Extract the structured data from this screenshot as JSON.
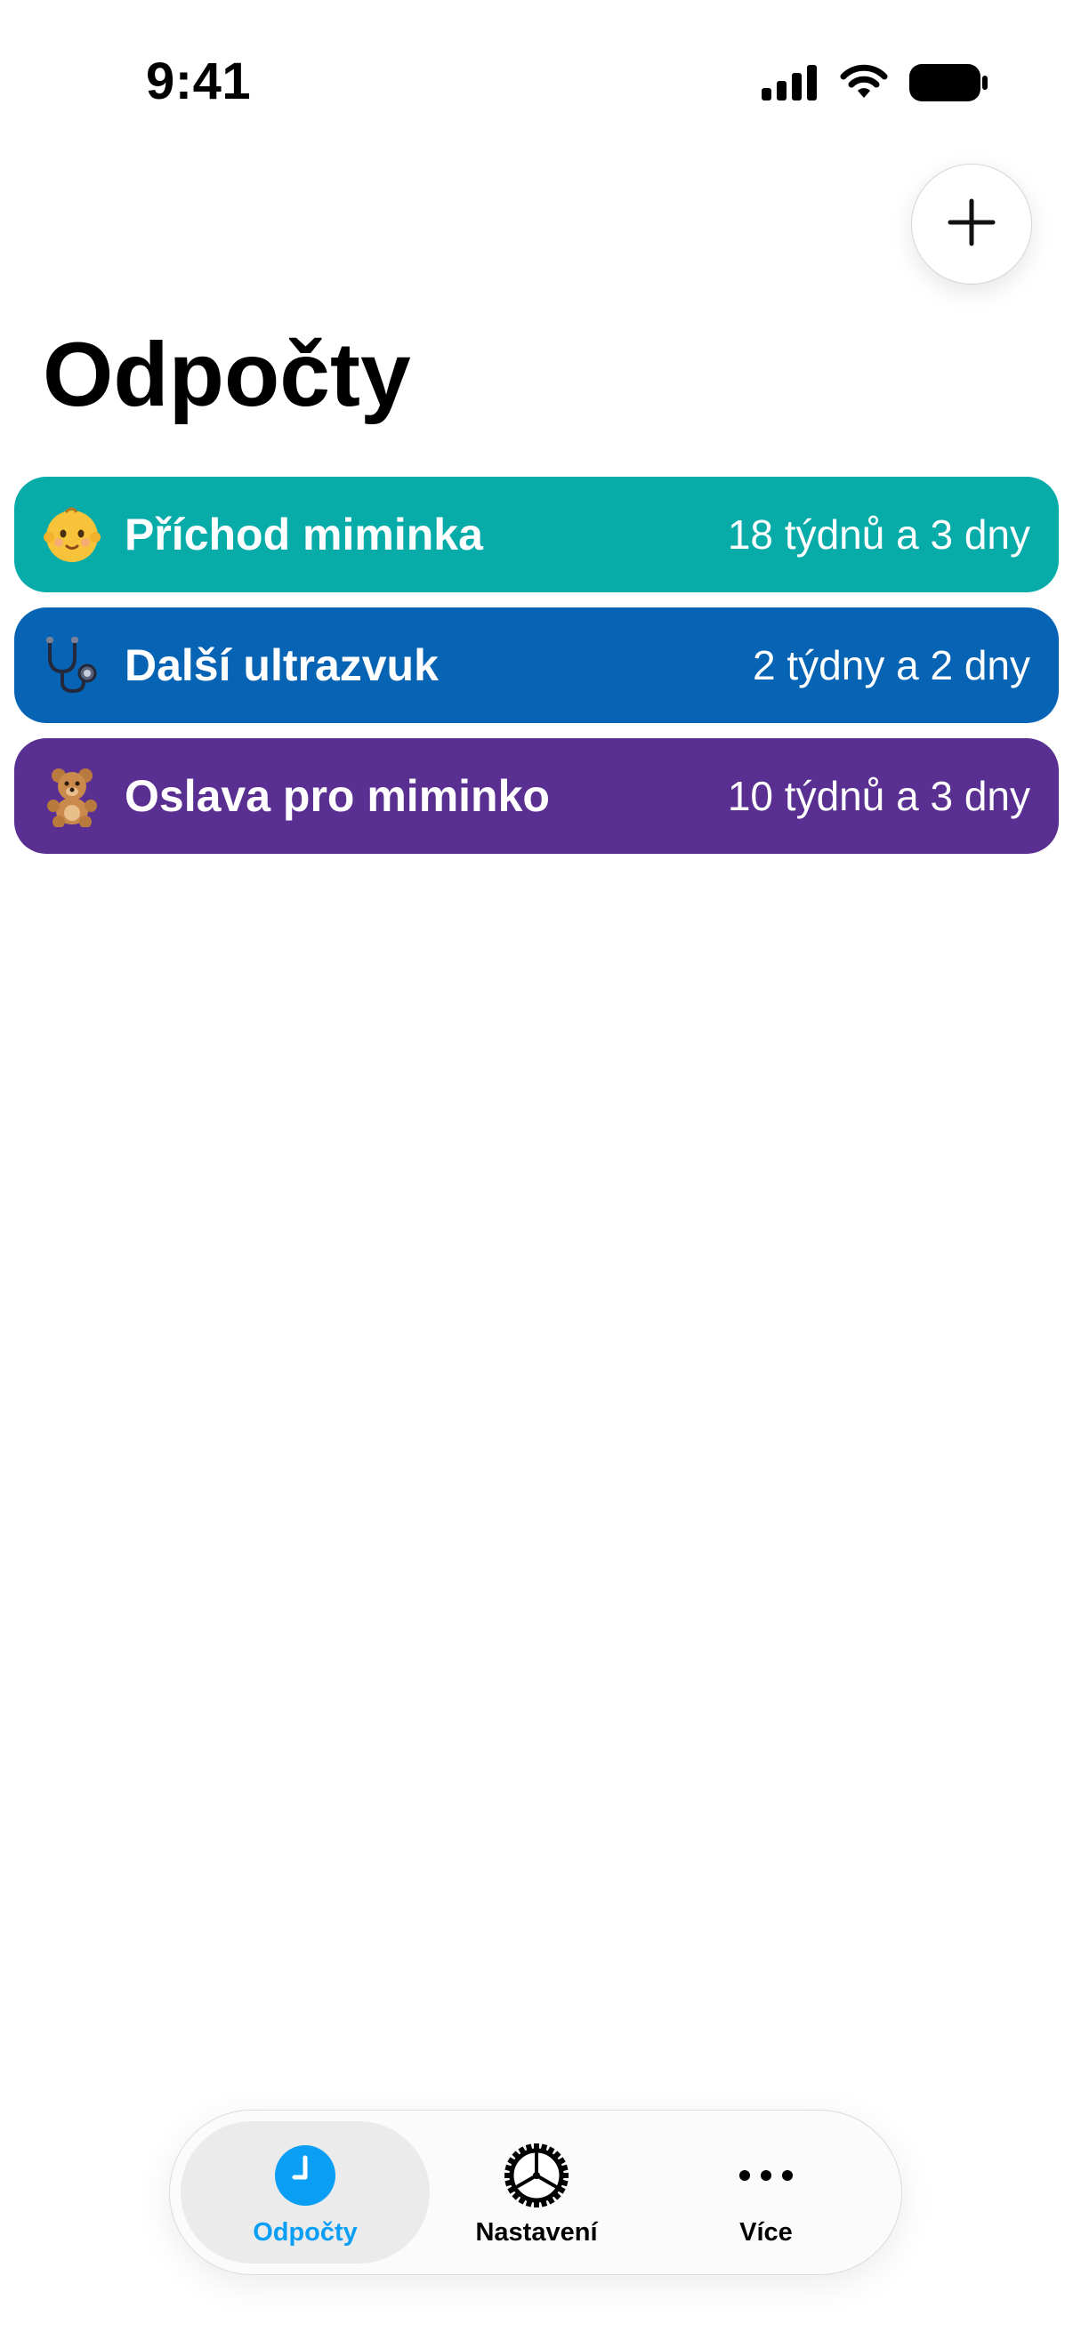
{
  "status_bar": {
    "time": "9:41",
    "icons": [
      "cellular-signal-icon",
      "wifi-icon",
      "battery-icon"
    ]
  },
  "header": {
    "add_icon": "plus-icon",
    "title": "Odpočty"
  },
  "countdowns": [
    {
      "emoji": "baby",
      "title": "Příchod miminka",
      "remaining": "18 týdnů a 3 dny",
      "color": "#07ACA9"
    },
    {
      "emoji": "stethoscope",
      "title": "Další ultrazvuk",
      "remaining": "2 týdny a 2 dny",
      "color": "#0764B4"
    },
    {
      "emoji": "teddy-bear",
      "title": "Oslava pro miminko",
      "remaining": "10 týdnů a 3 dny",
      "color": "#5A2F92"
    }
  ],
  "tab_bar": {
    "selected_index": 0,
    "accent": "#0A9EF5",
    "tabs": [
      {
        "label": "Odpočty",
        "icon": "clock-icon"
      },
      {
        "label": "Nastavení",
        "icon": "gear-icon"
      },
      {
        "label": "Více",
        "icon": "more-icon"
      }
    ]
  }
}
